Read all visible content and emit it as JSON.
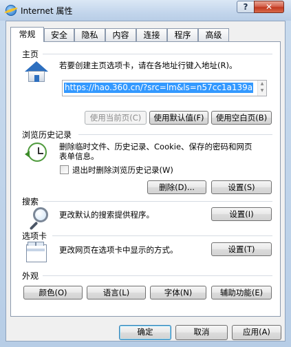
{
  "window": {
    "title": "Internet 属性"
  },
  "titlebar": {
    "help_glyph": "?",
    "close_glyph": "✕"
  },
  "tabs": [
    {
      "label": "常规",
      "active": true
    },
    {
      "label": "安全"
    },
    {
      "label": "隐私"
    },
    {
      "label": "内容"
    },
    {
      "label": "连接"
    },
    {
      "label": "程序"
    },
    {
      "label": "高级"
    }
  ],
  "home": {
    "section_title": "主页",
    "description": "若要创建主页选项卡，请在各地址行键入地址(R)。",
    "url": "https://hao.360.cn/?src=lm&ls=n57cc1a139a",
    "btn_use_current": "使用当前页(C)",
    "btn_use_default": "使用默认值(F)",
    "btn_use_blank": "使用空白页(B)"
  },
  "history": {
    "section_title": "浏览历史记录",
    "description_line1": "删除临时文件、历史记录、Cookie、保存的密码和网页",
    "description_line2": "表单信息。",
    "checkbox_label": "退出时删除浏览历史记录(W)",
    "checkbox_checked": false,
    "btn_delete": "删除(D)...",
    "btn_settings": "设置(S)"
  },
  "search": {
    "section_title": "搜索",
    "description": "更改默认的搜索提供程序。",
    "btn_settings": "设置(I)"
  },
  "tabs_section": {
    "section_title": "选项卡",
    "description": "更改网页在选项卡中显示的方式。",
    "btn_settings": "设置(T)"
  },
  "appearance": {
    "section_title": "外观",
    "btn_colors": "颜色(O)",
    "btn_languages": "语言(L)",
    "btn_fonts": "字体(N)",
    "btn_accessibility": "辅助功能(E)"
  },
  "footer": {
    "btn_ok": "确定",
    "btn_cancel": "取消",
    "btn_apply": "应用(A)"
  },
  "colors": {
    "selection": "#3399ff",
    "accent": "#2d6fbf"
  }
}
